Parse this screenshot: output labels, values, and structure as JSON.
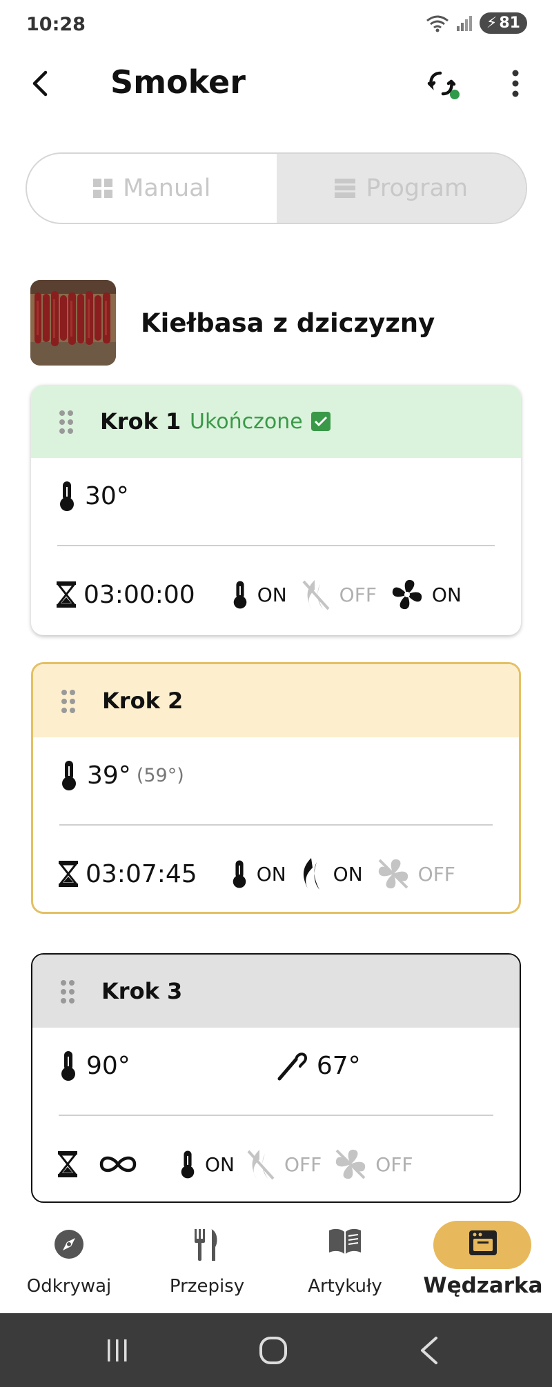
{
  "status": {
    "time": "10:28",
    "battery": "81"
  },
  "header": {
    "title": "Smoker"
  },
  "mode": {
    "manual": "Manual",
    "program": "Program"
  },
  "recipe": {
    "name": "Kiełbasa z dziczyzny"
  },
  "steps": [
    {
      "title": "Krok 1",
      "status": "Ukończone",
      "temp": "30°",
      "time": "03:00:00",
      "heater": "ON",
      "smoke": "OFF",
      "fan": "ON"
    },
    {
      "title": "Krok  2",
      "temp": "39°",
      "temp_current": "(59°)",
      "time": "03:07:45",
      "heater": "ON",
      "smoke": "ON",
      "fan": "OFF"
    },
    {
      "title": "Krok 3",
      "temp": "90°",
      "probe_temp": "67°",
      "heater": "ON",
      "smoke": "OFF",
      "fan": "OFF"
    }
  ],
  "nav": {
    "discover": "Odkrywaj",
    "recipes": "Przepisy",
    "articles": "Artykuły",
    "smoker": "Wędzarka"
  },
  "colors": {
    "done_bg": "#dbf3dc",
    "active_bg": "#fdefcd",
    "active_border": "#e4c064",
    "accent": "#e7b95c",
    "done_text": "#3a9948"
  }
}
